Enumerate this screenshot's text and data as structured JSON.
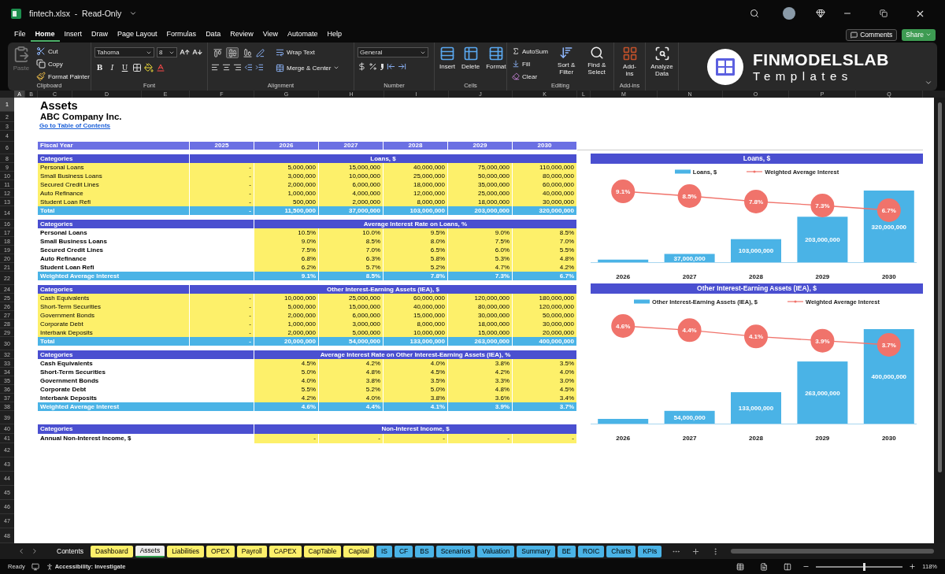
{
  "window": {
    "title": "fintech.xlsx  -  Read-Only"
  },
  "menu_tabs": [
    {
      "label": "File",
      "selected": false
    },
    {
      "label": "Home",
      "selected": true
    },
    {
      "label": "Insert",
      "selected": false
    },
    {
      "label": "Draw",
      "selected": false
    },
    {
      "label": "Page Layout",
      "selected": false
    },
    {
      "label": "Formulas",
      "selected": false
    },
    {
      "label": "Data",
      "selected": false
    },
    {
      "label": "Review",
      "selected": false
    },
    {
      "label": "View",
      "selected": false
    },
    {
      "label": "Automate",
      "selected": false
    },
    {
      "label": "Help",
      "selected": false
    }
  ],
  "actions": {
    "comments": "Comments",
    "share": "Share"
  },
  "ribbon": {
    "clipboard": {
      "label": "Clipboard",
      "paste": {
        "label": "Paste",
        "disabled": true
      },
      "cut": "Cut",
      "copy": "Copy",
      "format_painter": "Format Painter"
    },
    "font": {
      "label": "Font",
      "font_name": "Tahoma",
      "font_size": "8",
      "bold": "B",
      "italic": "I",
      "underline": "U"
    },
    "alignment": {
      "label": "Alignment",
      "vertical": [
        {
          "selected": false
        },
        {
          "selected": true
        },
        {
          "selected": false
        }
      ],
      "wrap_text": "Wrap Text",
      "merge_center": "Merge & Center"
    },
    "number": {
      "label": "Number",
      "format": "General"
    },
    "cells": {
      "label": "Cells",
      "buttons": [
        "Insert",
        "Delete",
        "Format"
      ]
    },
    "editing": {
      "label": "Editing",
      "autosum": "AutoSum",
      "fill": "Fill",
      "clear": "Clear",
      "sort_filter": "Sort & Filter",
      "find_select": "Find & Select"
    },
    "addins": {
      "label": "Add-ins",
      "button": "Add-ins"
    },
    "analyze": {
      "button": "Analyze Data"
    },
    "brand": {
      "name": "FINMODELSLAB",
      "tagline": "Templates"
    }
  },
  "column_headers": [
    {
      "label": "A",
      "selected": true
    },
    {
      "label": "B",
      "selected": false
    },
    {
      "label": "C",
      "selected": false
    },
    {
      "label": "D",
      "selected": false
    },
    {
      "label": "E",
      "selected": false
    },
    {
      "label": "F",
      "selected": false
    },
    {
      "label": "G",
      "selected": false
    },
    {
      "label": "H",
      "selected": false
    },
    {
      "label": "I",
      "selected": false
    },
    {
      "label": "J",
      "selected": false
    },
    {
      "label": "K",
      "selected": false
    },
    {
      "label": "L",
      "selected": false
    },
    {
      "label": "M",
      "selected": false
    },
    {
      "label": "N",
      "selected": false
    },
    {
      "label": "O",
      "selected": false
    },
    {
      "label": "P",
      "selected": false
    },
    {
      "label": "Q",
      "selected": false
    }
  ],
  "row_numbers": [
    {
      "label": "1",
      "selected": true
    },
    {
      "label": "2",
      "selected": false
    },
    {
      "label": "3",
      "selected": false
    },
    {
      "label": "4",
      "selected": false
    },
    {
      "label": "6",
      "selected": false
    },
    {
      "label": "8",
      "selected": false
    },
    {
      "label": "9",
      "selected": false
    },
    {
      "label": "10",
      "selected": false
    },
    {
      "label": "11",
      "selected": false
    },
    {
      "label": "12",
      "selected": false
    },
    {
      "label": "13",
      "selected": false
    },
    {
      "label": "14",
      "selected": false
    },
    {
      "label": "16",
      "selected": false
    },
    {
      "label": "17",
      "selected": false
    },
    {
      "label": "18",
      "selected": false
    },
    {
      "label": "19",
      "selected": false
    },
    {
      "label": "20",
      "selected": false
    },
    {
      "label": "21",
      "selected": false
    },
    {
      "label": "22",
      "selected": false
    },
    {
      "label": "24",
      "selected": false
    },
    {
      "label": "25",
      "selected": false
    },
    {
      "label": "26",
      "selected": false
    },
    {
      "label": "27",
      "selected": false
    },
    {
      "label": "28",
      "selected": false
    },
    {
      "label": "29",
      "selected": false
    },
    {
      "label": "30",
      "selected": false
    },
    {
      "label": "32",
      "selected": false
    },
    {
      "label": "33",
      "selected": false
    },
    {
      "label": "34",
      "selected": false
    },
    {
      "label": "35",
      "selected": false
    },
    {
      "label": "36",
      "selected": false
    },
    {
      "label": "37",
      "selected": false
    },
    {
      "label": "38",
      "selected": false
    },
    {
      "label": "39",
      "selected": false
    },
    {
      "label": "40",
      "selected": false
    },
    {
      "label": "41",
      "selected": false
    },
    {
      "label": "42",
      "selected": false
    },
    {
      "label": "43",
      "selected": false
    },
    {
      "label": "44",
      "selected": false
    },
    {
      "label": "45",
      "selected": false
    },
    {
      "label": "46",
      "selected": false
    },
    {
      "label": "47",
      "selected": false
    },
    {
      "label": "48",
      "selected": false
    }
  ],
  "sheet": {
    "title": "Assets",
    "company": "ABC Company Inc.",
    "link": "Go to Table of Contents",
    "fiscal_year": {
      "label": "Fiscal Year",
      "years": [
        "2025",
        "2026",
        "2027",
        "2028",
        "2029",
        "2030"
      ]
    },
    "sections": [
      {
        "kind": "amounts",
        "header": "Categories",
        "title": "Loans, $",
        "rows": [
          {
            "label": "Personal Loans",
            "values": [
              "-",
              "5,000,000",
              "15,000,000",
              "40,000,000",
              "75,000,000",
              "110,000,000"
            ]
          },
          {
            "label": "Small Business Loans",
            "values": [
              "-",
              "3,000,000",
              "10,000,000",
              "25,000,000",
              "50,000,000",
              "80,000,000"
            ]
          },
          {
            "label": "Secured Credit Lines",
            "values": [
              "-",
              "2,000,000",
              "6,000,000",
              "18,000,000",
              "35,000,000",
              "60,000,000"
            ]
          },
          {
            "label": "Auto Refinance",
            "values": [
              "-",
              "1,000,000",
              "4,000,000",
              "12,000,000",
              "25,000,000",
              "40,000,000"
            ]
          },
          {
            "label": "Student Loan Refi",
            "values": [
              "-",
              "500,000",
              "2,000,000",
              "8,000,000",
              "18,000,000",
              "30,000,000"
            ]
          }
        ],
        "total": {
          "label": "Total",
          "values": [
            "-",
            "11,500,000",
            "37,000,000",
            "103,000,000",
            "203,000,000",
            "320,000,000"
          ]
        }
      },
      {
        "kind": "rates",
        "header": "Categories",
        "title": "Average Interest Rate on Loans, %",
        "rows": [
          {
            "label": "Personal Loans",
            "values": [
              "10.5%",
              "10.0%",
              "9.5%",
              "9.0%",
              "8.5%"
            ]
          },
          {
            "label": "Small Business Loans",
            "values": [
              "9.0%",
              "8.5%",
              "8.0%",
              "7.5%",
              "7.0%"
            ]
          },
          {
            "label": "Secured Credit Lines",
            "values": [
              "7.5%",
              "7.0%",
              "6.5%",
              "6.0%",
              "5.5%"
            ]
          },
          {
            "label": "Auto Refinance",
            "values": [
              "6.8%",
              "6.3%",
              "5.8%",
              "5.3%",
              "4.8%"
            ]
          },
          {
            "label": "Student Loan Refi",
            "values": [
              "6.2%",
              "5.7%",
              "5.2%",
              "4.7%",
              "4.2%"
            ]
          }
        ],
        "total": {
          "label": "Weighted Average Interest",
          "values": [
            "9.1%",
            "8.5%",
            "7.8%",
            "7.3%",
            "6.7%"
          ]
        }
      },
      {
        "kind": "amounts",
        "header": "Categories",
        "title": "Other Interest-Earning Assets (IEA), $",
        "rows": [
          {
            "label": "Cash Equivalents",
            "values": [
              "-",
              "10,000,000",
              "25,000,000",
              "60,000,000",
              "120,000,000",
              "180,000,000"
            ]
          },
          {
            "label": "Short-Term Securities",
            "values": [
              "-",
              "5,000,000",
              "15,000,000",
              "40,000,000",
              "80,000,000",
              "120,000,000"
            ]
          },
          {
            "label": "Government Bonds",
            "values": [
              "-",
              "2,000,000",
              "6,000,000",
              "15,000,000",
              "30,000,000",
              "50,000,000"
            ]
          },
          {
            "label": "Corporate Debt",
            "values": [
              "-",
              "1,000,000",
              "3,000,000",
              "8,000,000",
              "18,000,000",
              "30,000,000"
            ]
          },
          {
            "label": "Interbank Deposits",
            "values": [
              "-",
              "2,000,000",
              "5,000,000",
              "10,000,000",
              "15,000,000",
              "20,000,000"
            ]
          }
        ],
        "total": {
          "label": "Total",
          "values": [
            "-",
            "20,000,000",
            "54,000,000",
            "133,000,000",
            "263,000,000",
            "400,000,000"
          ]
        }
      },
      {
        "kind": "rates",
        "header": "Categories",
        "title": "Average Interest Rate on Other Interest-Earning Assets (IEA), %",
        "rows": [
          {
            "label": "Cash Equivalents",
            "values": [
              "4.5%",
              "4.2%",
              "4.0%",
              "3.8%",
              "3.5%"
            ]
          },
          {
            "label": "Short-Term Securities",
            "values": [
              "5.0%",
              "4.8%",
              "4.5%",
              "4.2%",
              "4.0%"
            ]
          },
          {
            "label": "Government Bonds",
            "values": [
              "4.0%",
              "3.8%",
              "3.5%",
              "3.3%",
              "3.0%"
            ]
          },
          {
            "label": "Corporate Debt",
            "values": [
              "5.5%",
              "5.2%",
              "5.0%",
              "4.8%",
              "4.5%"
            ]
          },
          {
            "label": "Interbank Deposits",
            "values": [
              "4.2%",
              "4.0%",
              "3.8%",
              "3.6%",
              "3.4%"
            ]
          }
        ],
        "total": {
          "label": "Weighted Average Interest",
          "values": [
            "4.6%",
            "4.4%",
            "4.1%",
            "3.9%",
            "3.7%"
          ]
        }
      },
      {
        "kind": "rates",
        "header": "Categories",
        "title": "Non-Interest Income, $",
        "rows": [
          {
            "label": "Annual Non-Interest Income, $",
            "values": [
              "-",
              "-",
              "-",
              "-",
              "-"
            ]
          }
        ]
      }
    ]
  },
  "charts": [
    {
      "bars": {
        "chart_data": {
          "type": "bar",
          "title": "Loans, $",
          "categories": [
            "2026",
            "2027",
            "2028",
            "2029",
            "2030"
          ],
          "series": [
            {
              "name": "Loans, $",
              "color": "#4ab3e6",
              "values": [
                11500000,
                37000000,
                103000000,
                203000000,
                320000000
              ],
              "value_labels": [
                null,
                "37,000,000",
                "103,000,000",
                "203,000,000",
                "320,000,000"
              ]
            }
          ]
        }
      },
      "trend": {
        "chart_data": {
          "type": "line",
          "series": [
            {
              "name": "Weighted Average Interest",
              "color": "#f0736b",
              "marker": "circle",
              "values": [
                9.1,
                8.5,
                7.8,
                7.3,
                6.7
              ],
              "value_labels": [
                "9.1%",
                "8.5%",
                "7.8%",
                "7.3%",
                "6.7%"
              ]
            }
          ]
        }
      }
    },
    {
      "bars": {
        "chart_data": {
          "type": "bar",
          "title": "Other Interest-Earning Assets (IEA), $",
          "categories": [
            "2026",
            "2027",
            "2028",
            "2029",
            "2030"
          ],
          "series": [
            {
              "name": "Other Interest-Earning Assets (IEA), $",
              "color": "#4ab3e6",
              "values": [
                20000000,
                54000000,
                133000000,
                263000000,
                400000000
              ],
              "value_labels": [
                null,
                "54,000,000",
                "133,000,000",
                "263,000,000",
                "400,000,000"
              ]
            }
          ]
        }
      },
      "trend": {
        "chart_data": {
          "type": "line",
          "series": [
            {
              "name": "Weighted Average Interest",
              "color": "#f0736b",
              "marker": "circle",
              "values": [
                4.6,
                4.4,
                4.1,
                3.9,
                3.7
              ],
              "value_labels": [
                "4.6%",
                "4.4%",
                "4.1%",
                "3.9%",
                "3.7%"
              ]
            }
          ]
        }
      }
    }
  ],
  "sheet_tabs": [
    {
      "label": "Contents",
      "selected": false
    },
    {
      "label": "Dashboard",
      "selected": false,
      "color": "#fdf06a"
    },
    {
      "label": "Assets",
      "selected": true
    },
    {
      "label": "Liabilities",
      "selected": false,
      "color": "#fdf06a"
    },
    {
      "label": "OPEX",
      "selected": false,
      "color": "#fdf06a"
    },
    {
      "label": "Payroll",
      "selected": false,
      "color": "#fdf06a"
    },
    {
      "label": "CAPEX",
      "selected": false,
      "color": "#fdf06a"
    },
    {
      "label": "CapTable",
      "selected": false,
      "color": "#fdf06a"
    },
    {
      "label": "Capital",
      "selected": false,
      "color": "#fdf06a"
    },
    {
      "label": "IS",
      "selected": false,
      "color": "#4ab3e6"
    },
    {
      "label": "CF",
      "selected": false,
      "color": "#4ab3e6"
    },
    {
      "label": "BS",
      "selected": false,
      "color": "#4ab3e6"
    },
    {
      "label": "Scenarios",
      "selected": false,
      "color": "#4ab3e6"
    },
    {
      "label": "Valuation",
      "selected": false,
      "color": "#4ab3e6"
    },
    {
      "label": "Summary",
      "selected": false,
      "color": "#4ab3e6"
    },
    {
      "label": "BE",
      "selected": false,
      "color": "#4ab3e6"
    },
    {
      "label": "ROIC",
      "selected": false,
      "color": "#4ab3e6"
    },
    {
      "label": "Charts",
      "selected": false,
      "color": "#4ab3e6"
    },
    {
      "label": "KPIs",
      "selected": false,
      "color": "#4ab3e6"
    }
  ],
  "status_bar": {
    "ready": "Ready",
    "accessibility": "Accessibility: Investigate",
    "zoom_slider": {
      "level": 0.54
    },
    "zoom": "118%"
  }
}
